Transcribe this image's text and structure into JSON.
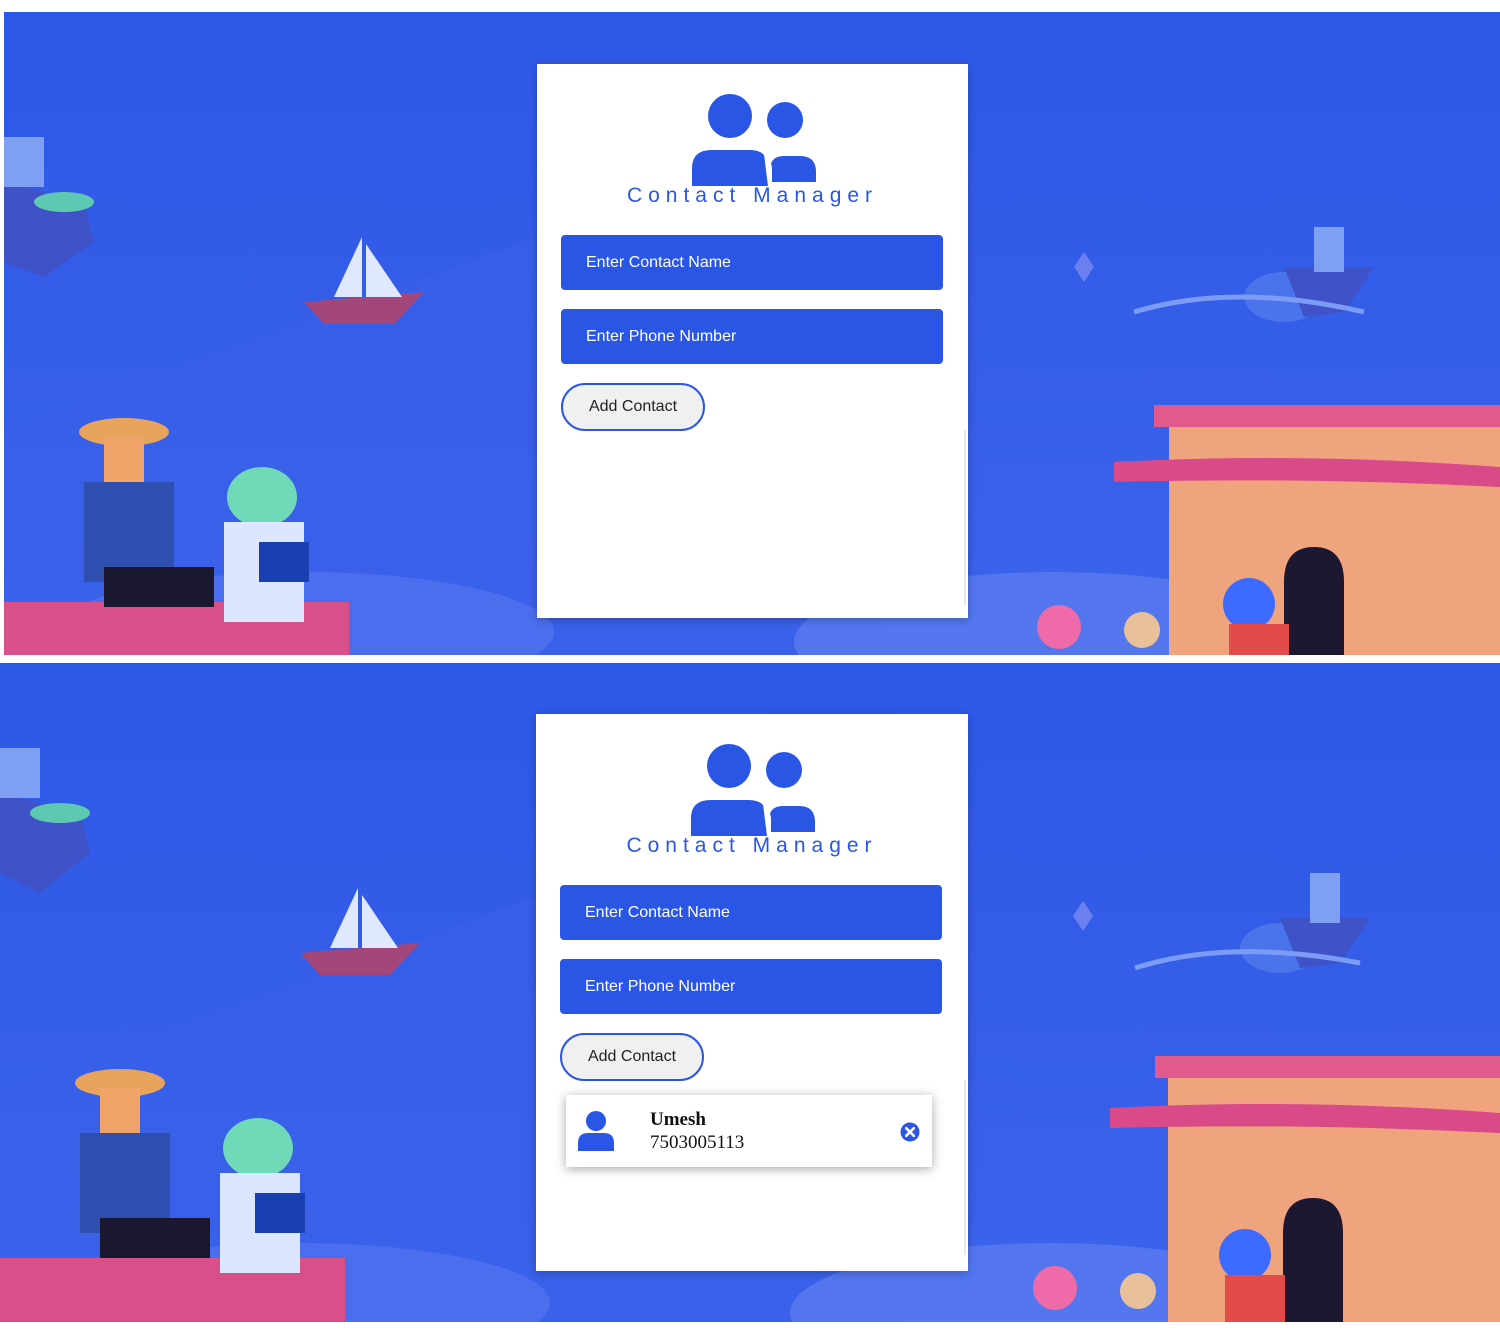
{
  "app": {
    "title": "Contact Manager"
  },
  "form": {
    "name_placeholder": "Enter Contact Name",
    "phone_placeholder": "Enter Phone Number",
    "add_label": "Add Contact"
  },
  "contacts": [
    {
      "name": "Umesh",
      "phone": "7503005113"
    }
  ],
  "colors": {
    "accent": "#2a56e6",
    "background": "#2f5be8",
    "button_bg": "#f0f0f0"
  },
  "icons": {
    "logo": "users-icon",
    "contact_avatar": "user-icon",
    "delete": "close-circle-icon"
  }
}
